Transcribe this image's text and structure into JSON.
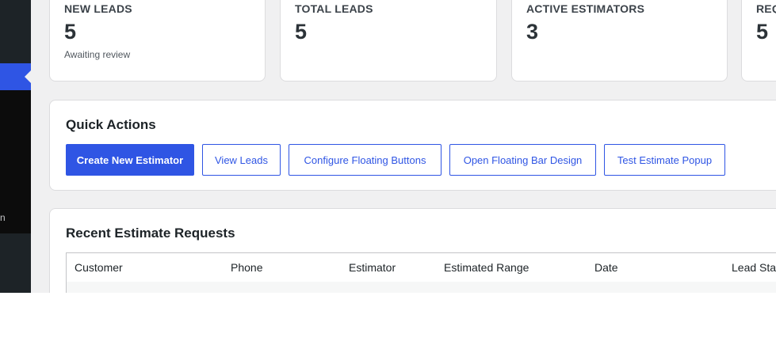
{
  "sidebar": {
    "submenu_fragment": "n"
  },
  "stats": [
    {
      "label": "NEW LEADS",
      "value": "5",
      "sub": "Awaiting review"
    },
    {
      "label": "TOTAL LEADS",
      "value": "5",
      "sub": ""
    },
    {
      "label": "ACTIVE ESTIMATORS",
      "value": "3",
      "sub": ""
    },
    {
      "label": "REQ",
      "value": "5",
      "sub": ""
    }
  ],
  "quick_actions": {
    "title": "Quick Actions",
    "buttons": [
      "Create New Estimator",
      "View Leads",
      "Configure Floating Buttons",
      "Open Floating Bar Design",
      "Test Estimate Popup"
    ]
  },
  "recent_requests": {
    "title": "Recent Estimate Requests",
    "columns": [
      "Customer",
      "Phone",
      "Estimator",
      "Estimated Range",
      "Date",
      "Lead Stat"
    ]
  },
  "colors": {
    "accent": "#2f55e4",
    "sidebar": "#1d2327",
    "background": "#f0f0f1"
  }
}
